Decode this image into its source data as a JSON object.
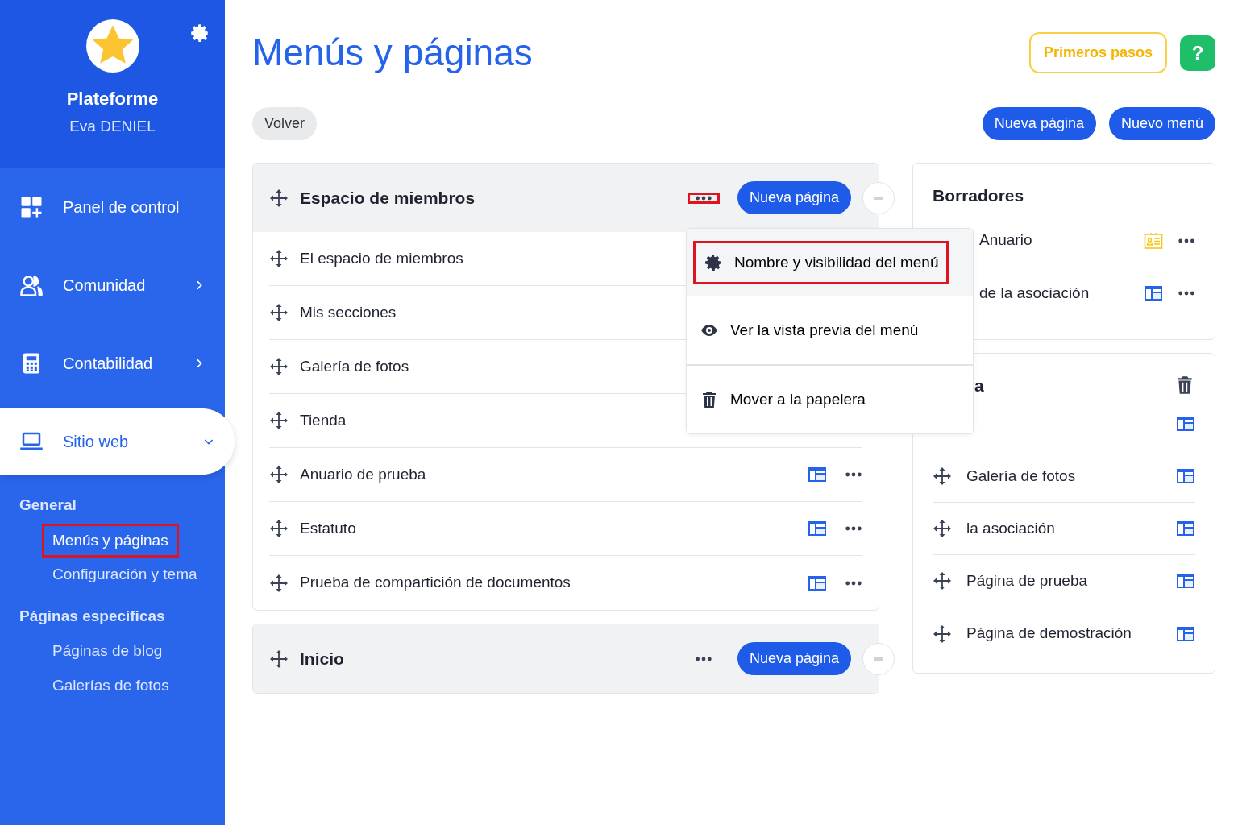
{
  "sidebar": {
    "org_name": "Plateforme",
    "user_name": "Eva DENIEL",
    "nav": [
      {
        "label": "Panel de control",
        "kind": "dashboard",
        "selected": false
      },
      {
        "label": "Comunidad",
        "kind": "community",
        "expanded": false,
        "selected": false
      },
      {
        "label": "Contabilidad",
        "kind": "accounting",
        "expanded": false,
        "selected": false
      },
      {
        "label": "Sitio web",
        "kind": "website",
        "expanded": true,
        "selected": true
      }
    ],
    "sections": [
      {
        "title": "General",
        "items": [
          {
            "label": "Menús y páginas",
            "selected": true,
            "highlighted": true
          },
          {
            "label": "Configuración y tema",
            "selected": false,
            "highlighted": false
          }
        ]
      },
      {
        "title": "Páginas específicas",
        "items": [
          {
            "label": "Páginas de blog",
            "selected": false,
            "highlighted": false
          },
          {
            "label": "Galerías de fotos",
            "selected": false,
            "highlighted": false
          }
        ]
      }
    ]
  },
  "header": {
    "title": "Menús y páginas",
    "getting_started": "Primeros pasos",
    "help": "?"
  },
  "toolbar": {
    "back": "Volver",
    "buttons": [
      "Nueva página",
      "Nuevo menú"
    ]
  },
  "menus": [
    {
      "title": "Espacio de miembros",
      "new_page": "Nueva página",
      "dots_highlighted": true,
      "items": [
        {
          "label": "El espacio de miembros"
        },
        {
          "label": "Mis secciones"
        },
        {
          "label": "Galería de fotos"
        },
        {
          "label": "Tienda"
        },
        {
          "label": "Anuario de prueba",
          "actions_visible": true
        },
        {
          "label": "Estatuto",
          "actions_visible": true
        },
        {
          "label": "Prueba de compartición de documentos",
          "actions_visible": true
        }
      ]
    },
    {
      "title": "Inicio",
      "new_page": "Nueva página",
      "dots_highlighted": false
    }
  ],
  "dropdown": [
    {
      "label": "Nombre y visibilidad del menú",
      "kind": "settings",
      "highlighted": true
    },
    {
      "label": "Ver la vista previa del menú",
      "kind": "preview",
      "highlighted": false
    },
    {
      "label": "Mover a la papelera",
      "kind": "trash",
      "highlighted": false
    }
  ],
  "drafts": {
    "title": "Borradores",
    "items": [
      {
        "label": "Anuario",
        "kind": "directory",
        "dots": true
      },
      {
        "label": "de la asociación",
        "kind": "page",
        "dots": true
      }
    ]
  },
  "trash_card": {
    "title": "a",
    "items": [
      {
        "kind": "page"
      },
      {
        "label": "Galería de fotos",
        "kind": "page",
        "handle": true
      },
      {
        "label": "la asociación",
        "kind": "page",
        "handle": true
      },
      {
        "label": "Página de prueba",
        "kind": "page",
        "handle": true
      },
      {
        "label": "Página de demostración",
        "kind": "page",
        "handle": true
      }
    ]
  }
}
